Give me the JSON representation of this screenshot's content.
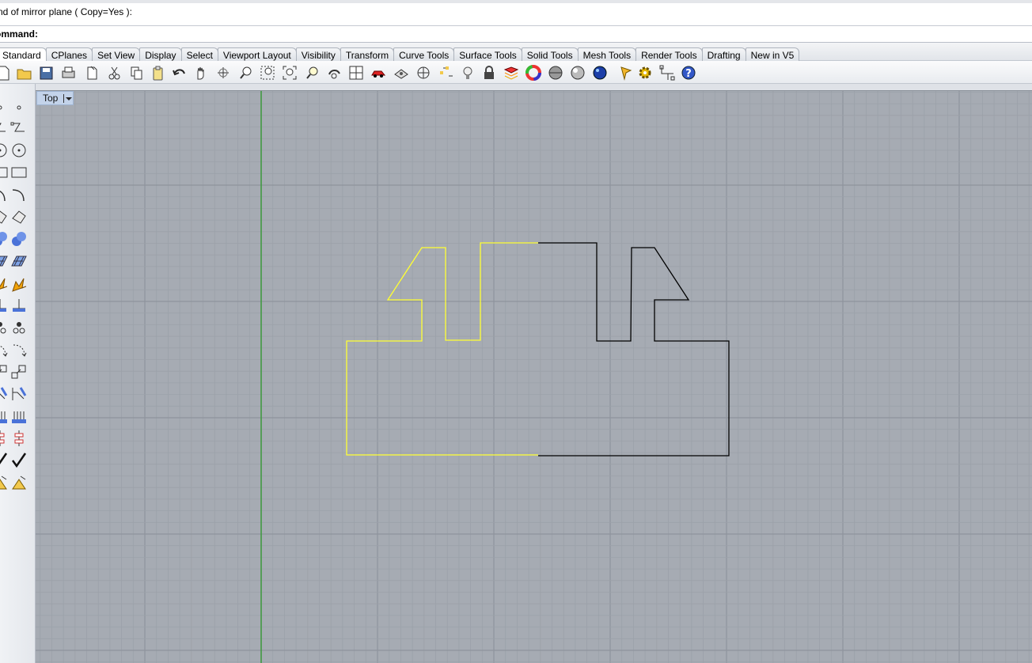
{
  "command_history": {
    "text": "nd of mirror plane ( Copy=Yes ):"
  },
  "command_line": {
    "label": "ommand:",
    "value": ""
  },
  "tabs": [
    {
      "label": "Standard",
      "active": true
    },
    {
      "label": "CPlanes"
    },
    {
      "label": "Set View"
    },
    {
      "label": "Display"
    },
    {
      "label": "Select"
    },
    {
      "label": "Viewport Layout"
    },
    {
      "label": "Visibility"
    },
    {
      "label": "Transform"
    },
    {
      "label": "Curve Tools"
    },
    {
      "label": "Surface Tools"
    },
    {
      "label": "Solid Tools"
    },
    {
      "label": "Mesh Tools"
    },
    {
      "label": "Render Tools"
    },
    {
      "label": "Drafting"
    },
    {
      "label": "New in V5"
    }
  ],
  "toolbar_icons": [
    "new-icon",
    "open-icon",
    "save-icon",
    "print-icon",
    "import-icon",
    "cut-icon",
    "copy-icon",
    "paste-icon",
    "undo-icon",
    "pan-icon",
    "rotate-view-icon",
    "zoom-dynamic-icon",
    "zoom-window-icon",
    "zoom-extents-icon",
    "zoom-selected-icon",
    "undo-view-icon",
    "four-viewports-icon",
    "car-icon",
    "named-views-icon",
    "cplane-icon",
    "grid-snap-icon",
    "lightbulb-icon",
    "lock-icon",
    "layer-icon",
    "color-wheel-icon",
    "shaded-sphere-icon",
    "rendered-sphere-icon",
    "render-icon",
    "options-icon",
    "gear-icon",
    "osnap-icon",
    "help-icon"
  ],
  "viewport": {
    "name": "Top",
    "dropdown": "viewport-menu"
  },
  "colors": {
    "viewport_bg": "#a6abb3",
    "grid_minor": "#9ba1a9",
    "grid_major": "#8e949d",
    "y_axis": "#3c9a3c",
    "selected_curve": "#ffff33",
    "curve": "#000000"
  }
}
